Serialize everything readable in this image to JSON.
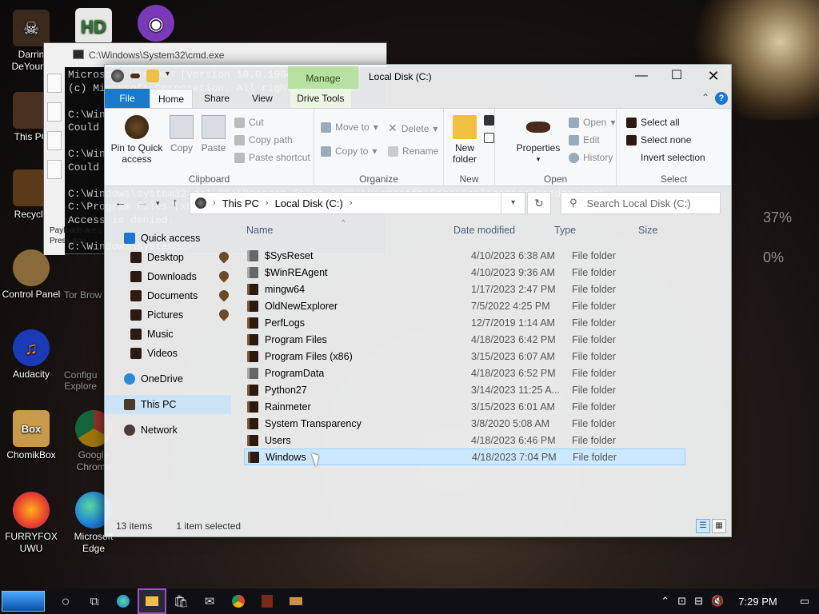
{
  "desktop": {
    "icons": [
      {
        "label": "Darrin\nDeYoung",
        "icon": "user-avatar-icon"
      },
      {
        "label": "This PC",
        "icon": "computer-icon"
      },
      {
        "label": "Recycle",
        "icon": "recycle-bin-icon"
      },
      {
        "label": "Control Panel",
        "icon": "control-panel-icon"
      },
      {
        "label": "Audacity",
        "icon": "audacity-icon"
      },
      {
        "label": "ChomikBox",
        "icon": "chomikbox-icon"
      },
      {
        "label": "FURRYFOX\nUWU",
        "icon": "firefox-icon"
      },
      {
        "label": "Microsoft\nEdge",
        "icon": "edge-icon"
      },
      {
        "label": "Google\nChrome",
        "icon": "chrome-icon"
      }
    ],
    "background_labels": [
      "Tor Brow",
      "Configu\nExplore"
    ],
    "widget_values": [
      "37%",
      "0%"
    ]
  },
  "cmd": {
    "title": "C:\\Windows\\System32\\cmd.exe",
    "lines": [
      "Microsoft Windows [Version 10.0.19045]",
      "(c) Microsoft Corporation. All rights reserved.",
      "",
      "C:\\Windows\\system32>takeown /f msedge.exe",
      "Could not find C:\\Windows\\System32\\explorer.exe",
      "",
      "C:\\Windows\\system32>takeown /f C:\\Windows",
      "Could not find C:\\Windows\\System32\\msedge.exe",
      "",
      "C:\\Windows\\system32>del \"C:\\Program Files (x86)\\Microsoft\\Edge\\Application\\msedge.exe\"",
      "C:\\Program Files (x86)\\Microsoft\\Edge\\Application\\msedge.exe",
      "Access is denied.",
      "",
      "C:\\Windows\\system32>"
    ],
    "note": "Payloads are c\nPress any"
  },
  "explorer": {
    "title": "Local Disk (C:)",
    "manage_tab": "Manage",
    "tabs": [
      "File",
      "Home",
      "Share",
      "View",
      "Drive Tools"
    ],
    "ribbon": {
      "clipboard": {
        "group": "Clipboard",
        "pin": "Pin to Quick\naccess",
        "copy": "Copy",
        "paste": "Paste",
        "cut": "Cut",
        "copy_path": "Copy path",
        "paste_shortcut": "Paste shortcut"
      },
      "organize": {
        "group": "Organize",
        "move_to": "Move to",
        "copy_to": "Copy to",
        "delete": "Delete",
        "rename": "Rename"
      },
      "new": {
        "group": "New",
        "new_folder": "New\nfolder"
      },
      "open": {
        "group": "Open",
        "properties": "Properties",
        "open": "Open",
        "edit": "Edit",
        "history": "History"
      },
      "select": {
        "group": "Select",
        "select_all": "Select all",
        "select_none": "Select none",
        "invert": "Invert selection"
      }
    },
    "address": {
      "crumbs": [
        "This PC",
        "Local Disk (C:)"
      ]
    },
    "search_placeholder": "Search Local Disk (C:)",
    "sidebar": [
      {
        "label": "Quick access",
        "icon": "star-icon",
        "level": 0,
        "pinned": false
      },
      {
        "label": "Desktop",
        "icon": "folder-icon",
        "level": 1,
        "pinned": true
      },
      {
        "label": "Downloads",
        "icon": "folder-icon",
        "level": 1,
        "pinned": true
      },
      {
        "label": "Documents",
        "icon": "folder-icon",
        "level": 1,
        "pinned": true
      },
      {
        "label": "Pictures",
        "icon": "folder-icon",
        "level": 1,
        "pinned": true
      },
      {
        "label": "Music",
        "icon": "folder-icon",
        "level": 1,
        "pinned": false
      },
      {
        "label": "Videos",
        "icon": "folder-icon",
        "level": 1,
        "pinned": false
      },
      {
        "label": "OneDrive",
        "icon": "cloud-icon",
        "level": 0,
        "pinned": false
      },
      {
        "label": "This PC",
        "icon": "computer-icon",
        "level": 0,
        "pinned": false,
        "selected": true
      },
      {
        "label": "Network",
        "icon": "network-icon",
        "level": 0,
        "pinned": false
      }
    ],
    "columns": [
      "Name",
      "Date modified",
      "Type",
      "Size"
    ],
    "files": [
      {
        "name": "$SysReset",
        "date": "4/10/2023 6:38 AM",
        "type": "File folder",
        "hidden": true
      },
      {
        "name": "$WinREAgent",
        "date": "4/10/2023 9:36 AM",
        "type": "File folder",
        "hidden": true
      },
      {
        "name": "mingw64",
        "date": "1/17/2023 2:47 PM",
        "type": "File folder"
      },
      {
        "name": "OldNewExplorer",
        "date": "7/5/2022 4:25 PM",
        "type": "File folder"
      },
      {
        "name": "PerfLogs",
        "date": "12/7/2019 1:14 AM",
        "type": "File folder"
      },
      {
        "name": "Program Files",
        "date": "4/18/2023 6:42 PM",
        "type": "File folder"
      },
      {
        "name": "Program Files (x86)",
        "date": "3/15/2023 6:07 AM",
        "type": "File folder"
      },
      {
        "name": "ProgramData",
        "date": "4/18/2023 6:52 PM",
        "type": "File folder",
        "hidden": true
      },
      {
        "name": "Python27",
        "date": "3/14/2023 11:25 A...",
        "type": "File folder"
      },
      {
        "name": "Rainmeter",
        "date": "3/15/2023 6:01 AM",
        "type": "File folder"
      },
      {
        "name": "System Transparency",
        "date": "3/8/2020 5:08 AM",
        "type": "File folder"
      },
      {
        "name": "Users",
        "date": "4/18/2023 6:46 PM",
        "type": "File folder"
      },
      {
        "name": "Windows",
        "date": "4/18/2023 7:04 PM",
        "type": "File folder",
        "selected": true
      }
    ],
    "status": {
      "count": "13 items",
      "selection": "1 item selected"
    }
  },
  "taskbar": {
    "apps": [
      "search-icon",
      "task-view-icon",
      "edge-icon",
      "file-explorer-icon",
      "store-icon",
      "mail-icon",
      "chrome-icon",
      "app-icon",
      "app-icon"
    ],
    "time": "7:29 PM"
  },
  "colors": {
    "file_tab": "#1979ca",
    "manage_tab": "#b8e0a0",
    "selection": "#cce8ff",
    "taskbar": "#101014"
  }
}
